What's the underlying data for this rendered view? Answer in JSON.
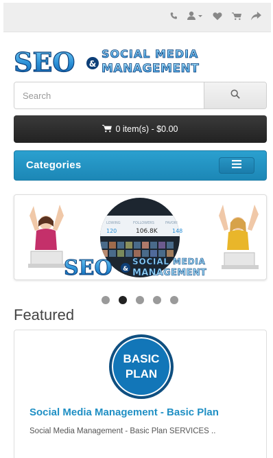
{
  "topbar": {
    "icons": [
      "phone-icon",
      "user-icon",
      "caret-down-icon",
      "heart-icon",
      "cart-icon",
      "share-icon"
    ]
  },
  "logo": {
    "seo": "SEO",
    "amp": "&",
    "social": "SOCIAL MEDIA",
    "management": "MANAGEMENT"
  },
  "search": {
    "placeholder": "Search",
    "value": ""
  },
  "cart": {
    "text": "0 item(s) - $0.00"
  },
  "categories": {
    "label": "Categories"
  },
  "slider": {
    "stats": {
      "col1_label": "LOWING",
      "col1_value": "120",
      "col2_label": "FOLLOWERS",
      "col2_value": "106.8K",
      "col3_label": "FAVORI",
      "col3_value": "148"
    },
    "logo_seo": "SEO",
    "logo_amp": "&",
    "logo_social": "SOCIAL MEDIA",
    "logo_management": "MANAGEMENT",
    "slides": 5,
    "active_slide": 2
  },
  "featured": {
    "title": "Featured",
    "product": {
      "badge_line1": "BASIC",
      "badge_line2": "PLAN",
      "name": "Social Media Management - Basic Plan",
      "description": "Social Media Management - Basic Plan  SERVICES  .."
    }
  },
  "colors": {
    "accent": "#1f8fc4",
    "categories_bar": "#239acb",
    "cart_bar": "#2b2b2b",
    "badge": "#1276b8"
  }
}
